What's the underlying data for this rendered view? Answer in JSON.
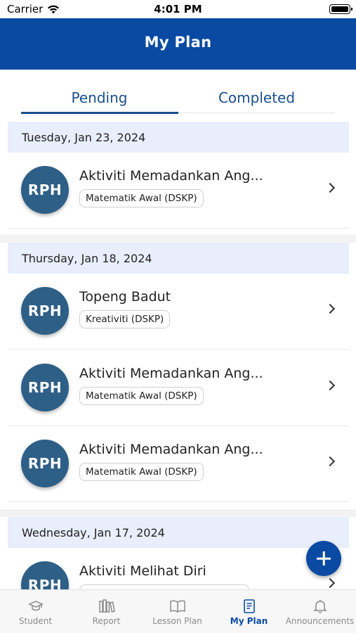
{
  "status_bar": {
    "carrier": "Carrier",
    "time": "4:01 PM"
  },
  "header": {
    "title": "My Plan"
  },
  "tabs": [
    {
      "label": "Pending",
      "active": true
    },
    {
      "label": "Completed",
      "active": false
    }
  ],
  "sections": [
    {
      "date": "Tuesday, Jan 23, 2024",
      "items": [
        {
          "badge": "RPH",
          "title": "Aktiviti Memadankan Ang...",
          "tag": "Matematik Awal (DSKP)"
        }
      ]
    },
    {
      "date": "Thursday, Jan 18, 2024",
      "items": [
        {
          "badge": "RPH",
          "title": "Topeng Badut",
          "tag": "Kreativiti (DSKP)"
        },
        {
          "badge": "RPH",
          "title": "Aktiviti Memadankan Ang...",
          "tag": "Matematik Awal (DSKP)"
        },
        {
          "badge": "RPH",
          "title": "Aktiviti Memadankan Ang...",
          "tag": "Matematik Awal (DSKP)"
        }
      ]
    },
    {
      "date": "Wednesday, Jan 17, 2024",
      "items": [
        {
          "badge": "RPH",
          "title": "Aktiviti Melihat Diri",
          "tag": ""
        }
      ]
    }
  ],
  "fab": {
    "icon": "plus-icon"
  },
  "bottom_nav": [
    {
      "label": "Student",
      "icon": "graduation-cap-icon",
      "active": false
    },
    {
      "label": "Report",
      "icon": "books-icon",
      "active": false
    },
    {
      "label": "Lesson Plan",
      "icon": "open-book-icon",
      "active": false
    },
    {
      "label": "My Plan",
      "icon": "document-icon",
      "active": true
    },
    {
      "label": "Announcements",
      "icon": "bell-icon",
      "active": false
    }
  ],
  "colors": {
    "primary": "#0b4aa3",
    "avatar": "#2e5f86",
    "date_header_bg": "#e8eefb",
    "tab_text": "#1b4f8c"
  }
}
